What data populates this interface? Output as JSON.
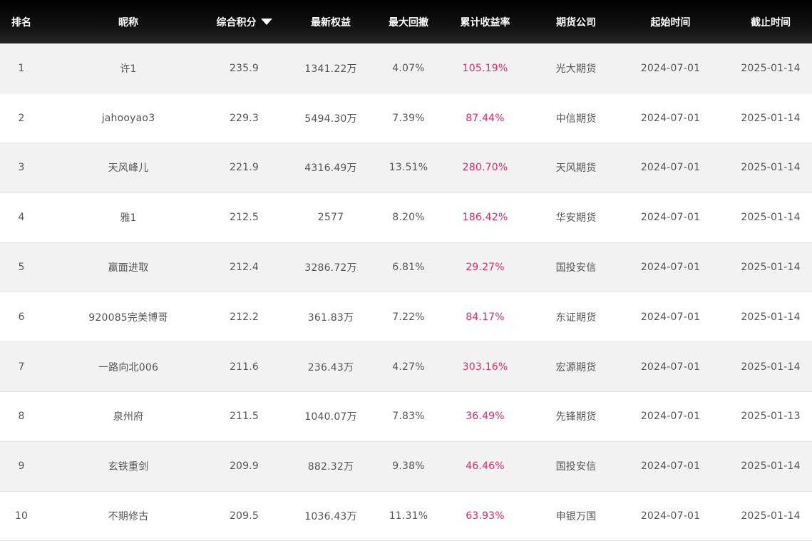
{
  "columns": {
    "rank": "排名",
    "nickname": "昵称",
    "score": "综合积分",
    "equity": "最新权益",
    "drawdown": "最大回撤",
    "return": "累计收益率",
    "company": "期货公司",
    "start": "起始时间",
    "end": "截止时间"
  },
  "sort": {
    "column": "score",
    "direction": "desc",
    "icon": "caret-down-icon"
  },
  "colors": {
    "header_bg": "#000000",
    "header_text": "#ffffff",
    "row_alt": "#f2f2f2",
    "text": "#555555",
    "return_highlight": "#e8246a"
  },
  "rows": [
    {
      "rank": "1",
      "nickname": "许1",
      "score": "235.9",
      "equity": "1341.22万",
      "drawdown": "4.07%",
      "return": "105.19%",
      "company": "光大期货",
      "start": "2024-07-01",
      "end": "2025-01-14"
    },
    {
      "rank": "2",
      "nickname": "jahooyao3",
      "score": "229.3",
      "equity": "5494.30万",
      "drawdown": "7.39%",
      "return": "87.44%",
      "company": "中信期货",
      "start": "2024-07-01",
      "end": "2025-01-14"
    },
    {
      "rank": "3",
      "nickname": "天风峰儿",
      "score": "221.9",
      "equity": "4316.49万",
      "drawdown": "13.51%",
      "return": "280.70%",
      "company": "天风期货",
      "start": "2024-07-01",
      "end": "2025-01-14"
    },
    {
      "rank": "4",
      "nickname": "雅1",
      "score": "212.5",
      "equity": "2577",
      "drawdown": "8.20%",
      "return": "186.42%",
      "company": "华安期货",
      "start": "2024-07-01",
      "end": "2025-01-14"
    },
    {
      "rank": "5",
      "nickname": "赢面进取",
      "score": "212.4",
      "equity": "3286.72万",
      "drawdown": "6.81%",
      "return": "29.27%",
      "company": "国投安信",
      "start": "2024-07-01",
      "end": "2025-01-14"
    },
    {
      "rank": "6",
      "nickname": "920085完美博哥",
      "score": "212.2",
      "equity": "361.83万",
      "drawdown": "7.22%",
      "return": "84.17%",
      "company": "东证期货",
      "start": "2024-07-01",
      "end": "2025-01-14"
    },
    {
      "rank": "7",
      "nickname": "一路向北006",
      "score": "211.6",
      "equity": "236.43万",
      "drawdown": "4.27%",
      "return": "303.16%",
      "company": "宏源期货",
      "start": "2024-07-01",
      "end": "2025-01-14"
    },
    {
      "rank": "8",
      "nickname": "泉州府",
      "score": "211.5",
      "equity": "1040.07万",
      "drawdown": "7.83%",
      "return": "36.49%",
      "company": "先锋期货",
      "start": "2024-07-01",
      "end": "2025-01-13"
    },
    {
      "rank": "9",
      "nickname": "玄铁重剑",
      "score": "209.9",
      "equity": "882.32万",
      "drawdown": "9.38%",
      "return": "46.46%",
      "company": "国投安信",
      "start": "2024-07-01",
      "end": "2025-01-14"
    },
    {
      "rank": "10",
      "nickname": "不期修古",
      "score": "209.5",
      "equity": "1036.43万",
      "drawdown": "11.31%",
      "return": "63.93%",
      "company": "申银万国",
      "start": "2024-07-01",
      "end": "2025-01-14"
    }
  ]
}
